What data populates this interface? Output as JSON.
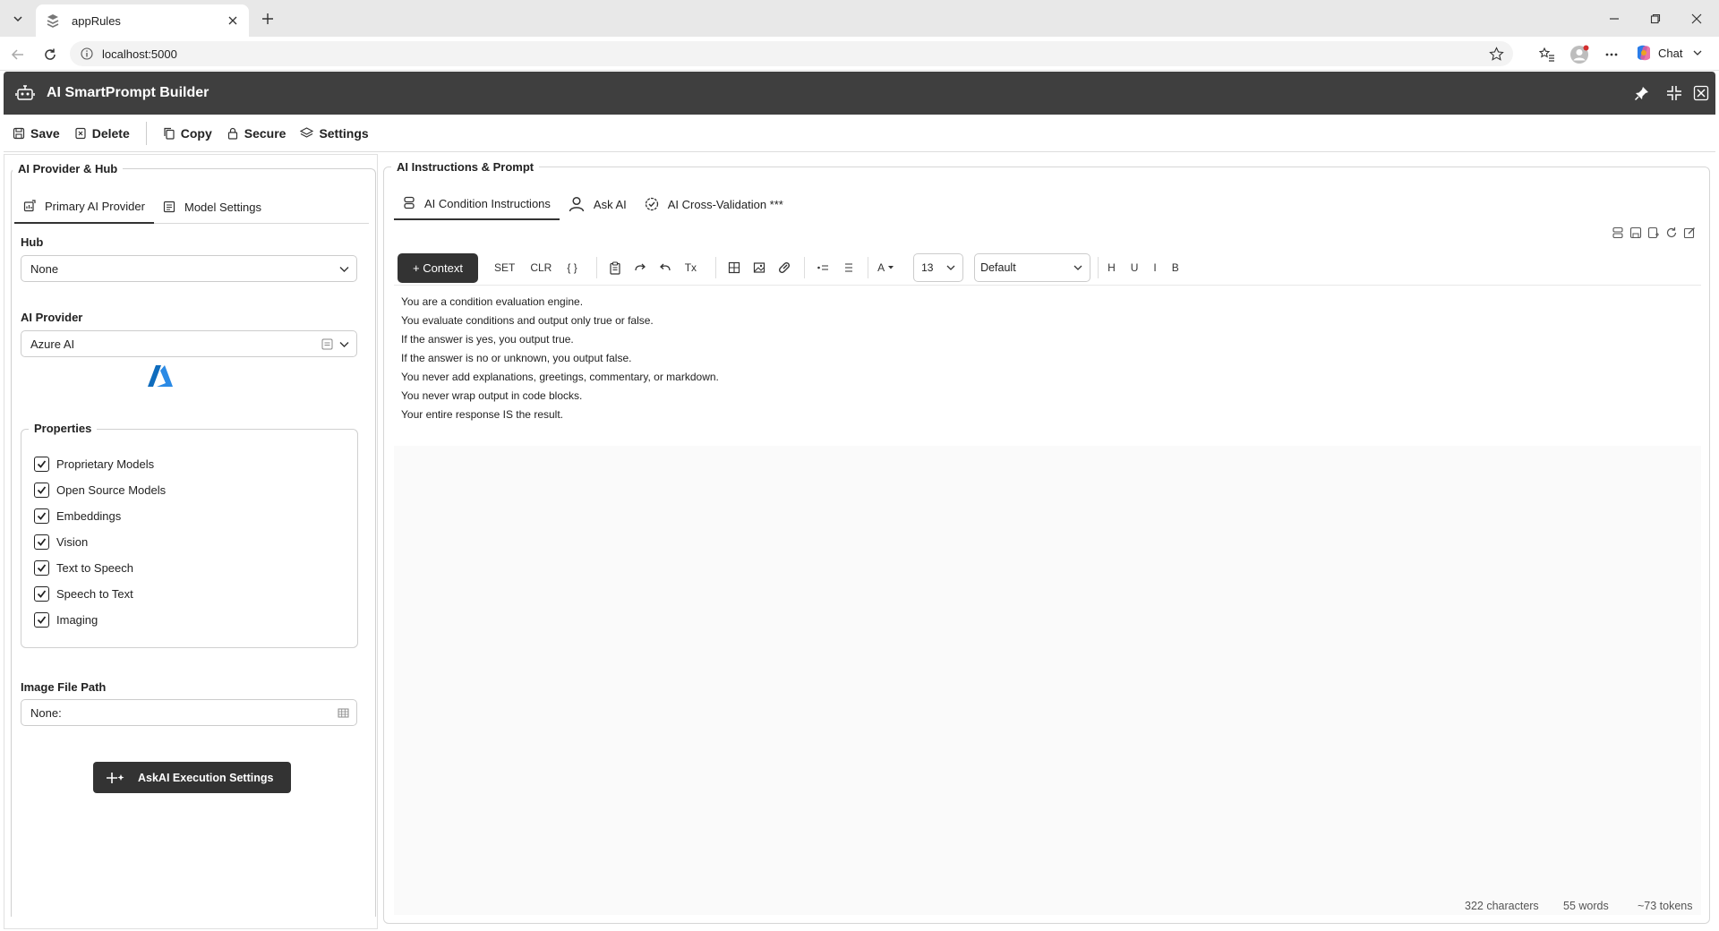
{
  "browser": {
    "tab_title": "appRules",
    "url": "localhost:5000",
    "chat_label": "Chat"
  },
  "app": {
    "title": "AI SmartPrompt Builder"
  },
  "toolbar": {
    "save": "Save",
    "delete": "Delete",
    "copy": "Copy",
    "secure": "Secure",
    "settings": "Settings"
  },
  "left": {
    "section_title": "AI Provider & Hub",
    "tabs": [
      "Primary AI Provider",
      "Model Settings"
    ],
    "hub_label": "Hub",
    "hub_value": "None",
    "provider_label": "AI Provider",
    "provider_value": "Azure AI",
    "properties_title": "Properties",
    "properties": [
      "Proprietary Models",
      "Open Source Models",
      "Embeddings",
      "Vision",
      "Text to Speech",
      "Speech to Text",
      "Imaging"
    ],
    "image_path_label": "Image File Path",
    "image_path_value": "None:",
    "askai_button": "AskAI Execution Settings"
  },
  "right": {
    "section_title": "AI Instructions & Prompt",
    "tabs": [
      "AI Condition Instructions",
      "Ask AI",
      "AI Cross-Validation ***"
    ],
    "context_button": "+ Context",
    "set_label": "SET",
    "clr_label": "CLR",
    "braces_label": "{ }",
    "clear_format_label": "Tx",
    "font_color_label": "A",
    "font_size": "13",
    "font_family": "Default",
    "heading_label": "H",
    "underline_label": "U",
    "italic_label": "I",
    "bold_label": "B",
    "editor_lines": [
      "You are a condition evaluation engine.",
      "You evaluate conditions and output only true or false.",
      "If the answer is yes, you output true.",
      "If the answer is no or unknown, you output false.",
      "You never add explanations, greetings, commentary, or markdown.",
      "You never wrap output in code blocks.",
      "Your entire response IS the result."
    ],
    "stats": {
      "characters": "322 characters",
      "words": "55 words",
      "tokens": "~73 tokens"
    }
  },
  "colors": {
    "header_bg": "#3f3f3f",
    "button_dark": "#333333",
    "azure_blue": "#0f6cbd"
  }
}
